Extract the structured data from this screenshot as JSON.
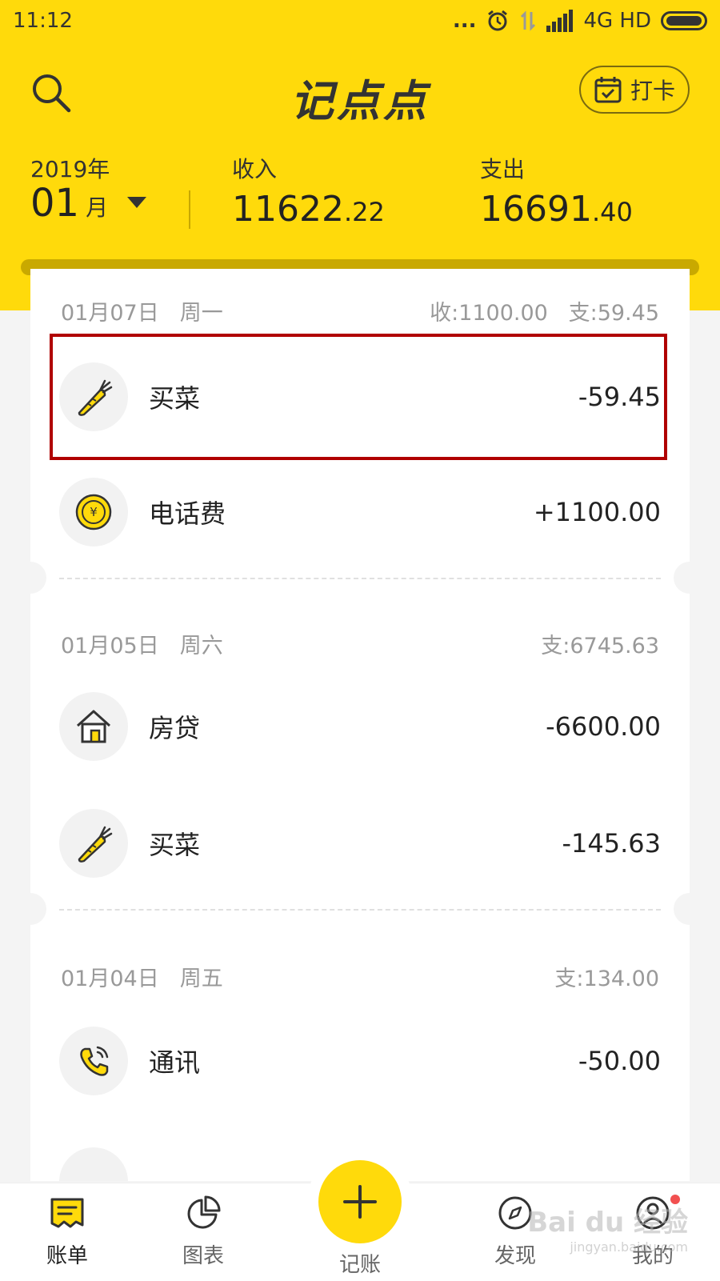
{
  "status_bar": {
    "time": "11:12",
    "dots": "...",
    "network": "4G HD"
  },
  "app": {
    "title": "记点点",
    "checkin_label": "打卡"
  },
  "summary": {
    "year": "2019年",
    "month": "01",
    "month_unit": "月",
    "income_label": "收入",
    "income_int": "11622",
    "income_dec": ".22",
    "expense_label": "支出",
    "expense_int": "16691",
    "expense_dec": ".40"
  },
  "days": [
    {
      "date": "01月07日",
      "weekday": "周一",
      "totals": "收:1100.00   支:59.45",
      "items": [
        {
          "label": "买菜",
          "amount": "-59.45",
          "icon": "carrot-icon"
        },
        {
          "label": "电话费",
          "amount": "+1100.00",
          "icon": "coin-icon"
        }
      ]
    },
    {
      "date": "01月05日",
      "weekday": "周六",
      "totals": "支:6745.63",
      "items": [
        {
          "label": "房贷",
          "amount": "-6600.00",
          "icon": "house-icon"
        },
        {
          "label": "买菜",
          "amount": "-145.63",
          "icon": "carrot-icon"
        }
      ]
    },
    {
      "date": "01月04日",
      "weekday": "周五",
      "totals": "支:134.00",
      "items": [
        {
          "label": "通讯",
          "amount": "-50.00",
          "icon": "phone-icon"
        }
      ]
    }
  ],
  "tabs": [
    {
      "label": "账单",
      "icon": "bill-icon"
    },
    {
      "label": "图表",
      "icon": "pie-chart-icon"
    },
    {
      "label": "记账",
      "icon": "plus-icon"
    },
    {
      "label": "发现",
      "icon": "compass-icon"
    },
    {
      "label": "我的",
      "icon": "user-icon"
    }
  ],
  "watermark": {
    "main": "Bai du 经验",
    "sub": "jingyan.baidu.com"
  },
  "colors": {
    "brand_yellow": "#FFDA0B",
    "highlight_red": "#B00000",
    "badge_red": "#F25050"
  }
}
